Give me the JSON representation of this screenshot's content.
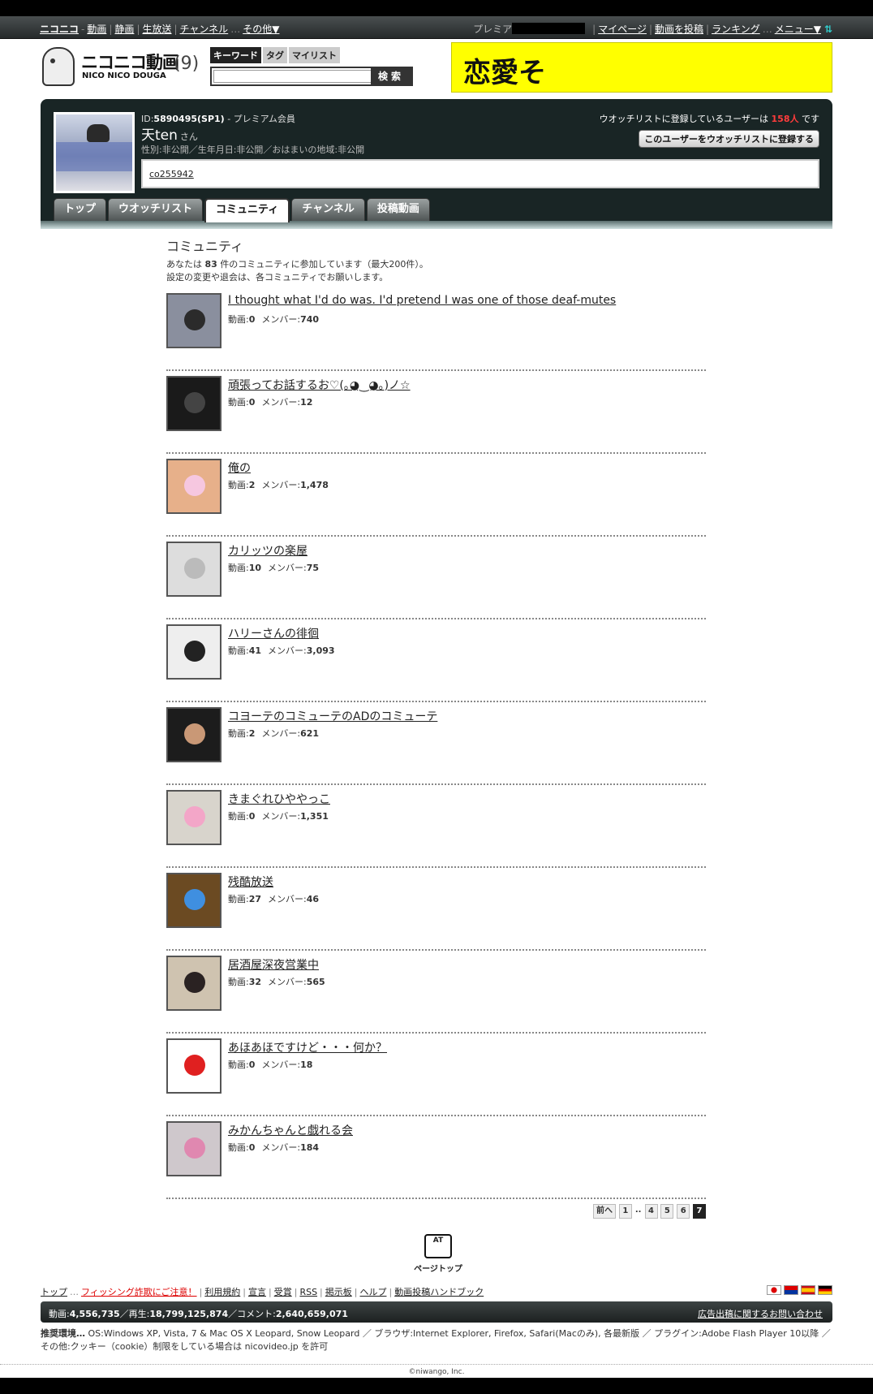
{
  "global_nav": {
    "brand": "ニコニコ",
    "items": [
      "動画",
      "静画",
      "生放送",
      "チャンネル",
      "その他▼"
    ],
    "premium_label": "プレミア",
    "right_items": [
      "マイページ",
      "動画を投稿",
      "ランキング",
      "メニュー▼"
    ]
  },
  "logo": {
    "title": "ニコニコ動画",
    "subtitle": "NICO NICO DOUGA",
    "count": "(9)"
  },
  "search": {
    "tabs": [
      "キーワード",
      "タグ",
      "マイリスト"
    ],
    "button": "検索",
    "value": ""
  },
  "banner": {
    "text": "恋愛そ"
  },
  "profile": {
    "id_label": "ID:",
    "id_value": "5890495(SP1)",
    "member_type": " - プレミアム会員",
    "name": "天ten",
    "honorific": "さん",
    "meta": "性別:非公開／生年月日:非公開／おはまいの地域:非公開",
    "watch_prefix": "ウオッチリストに登録しているユーザーは",
    "watch_count": "158人",
    "watch_suffix": "です",
    "watch_button": "このユーザーをウオッチリストに登録する",
    "description": "co255942"
  },
  "profile_tabs": [
    "トップ",
    "ウオッチリスト",
    "コミュニティ",
    "チャンネル",
    "投稿動画"
  ],
  "active_tab_index": 2,
  "community": {
    "heading": "コミュニティ",
    "info_prefix": "あなたは",
    "info_count": "83",
    "info_suffix": "件のコミュニティに参加しています（最大200件）。",
    "info_line2": "設定の変更や退会は、各コミュニティでお願いします。",
    "stat_video_label": "動画:",
    "stat_member_label": "メンバー:",
    "items": [
      {
        "name": "I thought what I'd do was. I'd pretend I was one of those deaf-mutes",
        "videos": "0",
        "members": "740",
        "thumb_bg": "#8a8f9e",
        "thumb_fg": "#2b2b2b"
      },
      {
        "name": "頑張ってお話するお♡(｡◕‿◕｡)ノ☆",
        "videos": "0",
        "members": "12",
        "thumb_bg": "#1a1a1a",
        "thumb_fg": "#444444"
      },
      {
        "name": "俺の",
        "videos": "2",
        "members": "1,478",
        "thumb_bg": "#e7b08a",
        "thumb_fg": "#f6c7e0"
      },
      {
        "name": "カリッツの楽屋",
        "videos": "10",
        "members": "75",
        "thumb_bg": "#dddddd",
        "thumb_fg": "#bbbbbb"
      },
      {
        "name": "ハリーさんの徘徊",
        "videos": "41",
        "members": "3,093",
        "thumb_bg": "#eeeeee",
        "thumb_fg": "#222222"
      },
      {
        "name": "コヨーテのコミューテのADのコミューテ",
        "videos": "2",
        "members": "621",
        "thumb_bg": "#1c1c1c",
        "thumb_fg": "#c99876"
      },
      {
        "name": "きまぐれひややっこ",
        "videos": "0",
        "members": "1,351",
        "thumb_bg": "#d8d4cc",
        "thumb_fg": "#f3a6c8"
      },
      {
        "name": "残酷放送",
        "videos": "27",
        "members": "46",
        "thumb_bg": "#6b4a22",
        "thumb_fg": "#3f8fe0"
      },
      {
        "name": "居酒屋深夜営業中",
        "videos": "32",
        "members": "565",
        "thumb_bg": "#cfc3b0",
        "thumb_fg": "#2a2222"
      },
      {
        "name": "あほあほですけど・・・何か？",
        "videos": "0",
        "members": "18",
        "thumb_bg": "#ffffff",
        "thumb_fg": "#e02020"
      },
      {
        "name": "みかんちゃんと戯れる会",
        "videos": "0",
        "members": "184",
        "thumb_bg": "#cfc8cc",
        "thumb_fg": "#e088b0"
      }
    ]
  },
  "pager": {
    "prev": "前へ",
    "pages": [
      "1",
      "..",
      "4",
      "5",
      "6",
      "7"
    ],
    "current": "7"
  },
  "pagetop": {
    "robot": "AT",
    "label": "ページトップ"
  },
  "footer": {
    "links": [
      "トップ",
      "フィッシング詐欺にご注意！",
      "利用規約",
      "宣言",
      "受賞",
      "RSS",
      "掲示板",
      "ヘルプ",
      "動画投稿ハンドブック"
    ],
    "stats_video_label": "動画:",
    "stats_video": "4,556,735",
    "stats_play_label": "／再生:",
    "stats_play": "18,799,125,874",
    "stats_comment_label": "／コメント:",
    "stats_comment": "2,640,659,071",
    "ad_link": "広告出稿に関するお問い合わせ",
    "env_label": "推奨環境…",
    "env_text": "OS:Windows XP, Vista, 7 & Mac OS X Leopard, Snow Leopard ／ ブラウザ:Internet Explorer, Firefox, Safari(Macのみ), 各最新版 ／ プラグイン:Adobe Flash Player 10以降 ／",
    "env_text2": "その他:クッキー（cookie）制限をしている場合は nicovideo.jp を許可",
    "copyright": "©niwango, Inc."
  },
  "colors": {
    "accent_red": "#ff3c3c",
    "banner_yellow": "#ffff00",
    "panel_dark": "#192525"
  }
}
